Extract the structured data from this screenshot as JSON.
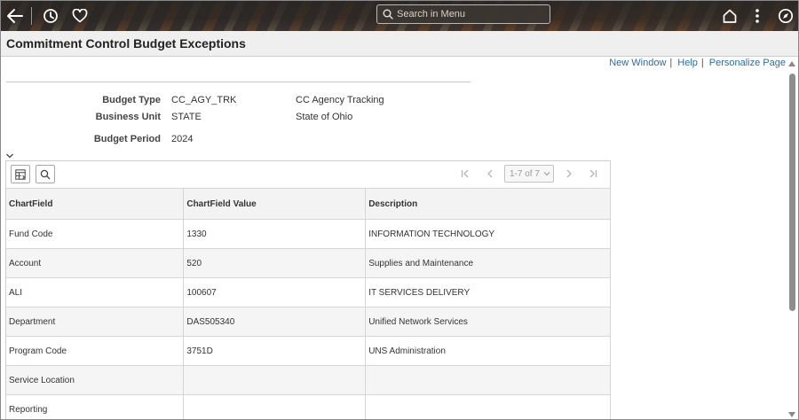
{
  "topbar": {
    "search_placeholder": "Search in Menu",
    "icons": [
      "back-arrow-icon",
      "history-icon",
      "favorites-heart-icon",
      "home-icon",
      "more-vertical-icon",
      "navbar-compass-icon"
    ]
  },
  "page": {
    "title": "Commitment Control Budget Exceptions"
  },
  "links": {
    "new_window": "New Window",
    "help": "Help",
    "personalize": "Personalize Page",
    "separator": "|"
  },
  "header": {
    "budget_type_label": "Budget Type",
    "budget_type_value": "CC_AGY_TRK",
    "budget_type_desc": "CC Agency Tracking",
    "business_unit_label": "Business Unit",
    "business_unit_value": "STATE",
    "business_unit_desc": "State of Ohio",
    "budget_period_label": "Budget Period",
    "budget_period_value": "2024"
  },
  "grid": {
    "pager_text": "1-7 of 7",
    "columns": [
      "ChartField",
      "ChartField Value",
      "Description"
    ],
    "rows": [
      {
        "chartfield": "Fund Code",
        "value": "1330",
        "description": "INFORMATION TECHNOLOGY"
      },
      {
        "chartfield": "Account",
        "value": "520",
        "description": "Supplies and Maintenance"
      },
      {
        "chartfield": "ALI",
        "value": "100607",
        "description": "IT SERVICES DELIVERY"
      },
      {
        "chartfield": "Department",
        "value": "DAS505340",
        "description": "Unified Network Services"
      },
      {
        "chartfield": "Program Code",
        "value": "3751D",
        "description": "UNS Administration"
      },
      {
        "chartfield": "Service Location",
        "value": "",
        "description": ""
      },
      {
        "chartfield": "Reporting",
        "value": "",
        "description": ""
      }
    ]
  },
  "colors": {
    "link": "#2d6ca2",
    "title_bar": "#efefef",
    "banner": "#3b3735"
  }
}
